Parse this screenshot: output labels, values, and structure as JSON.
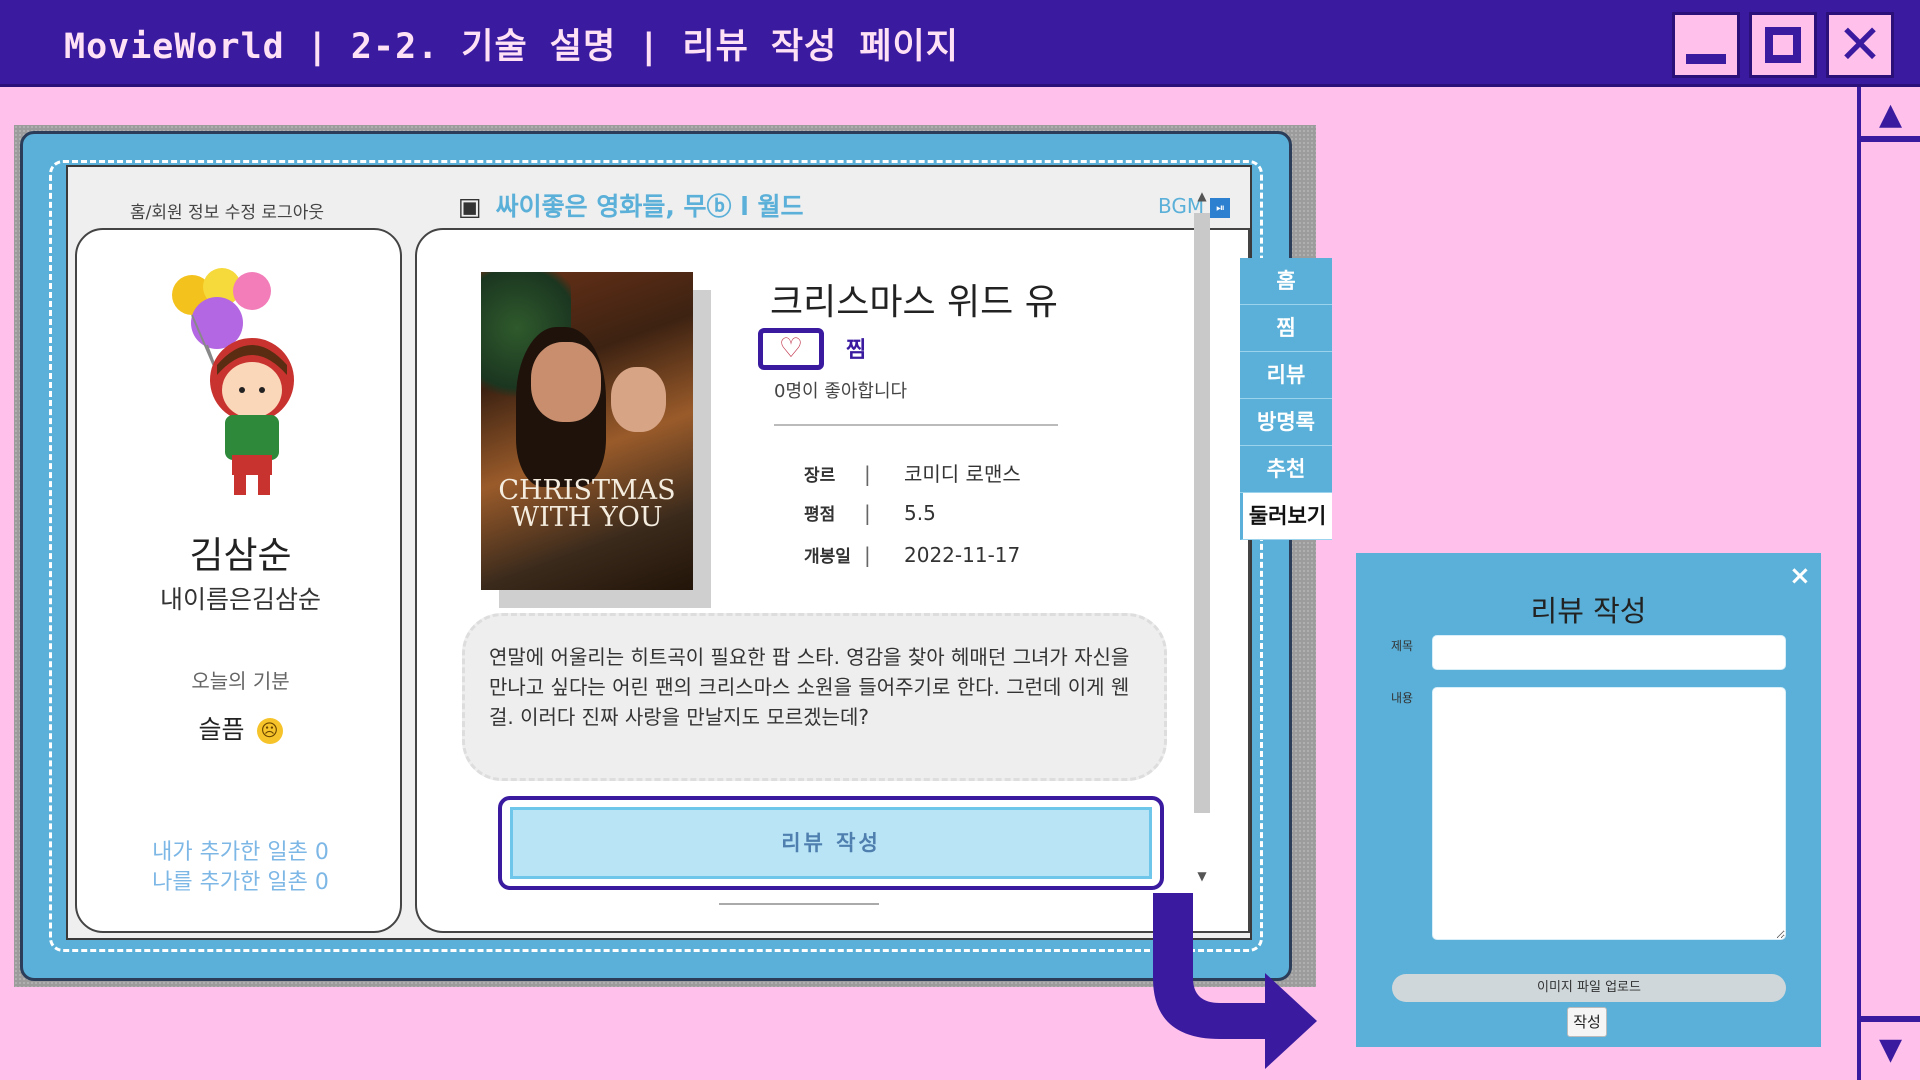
{
  "window": {
    "title": "MovieWorld | 2-2. 기술 설명 | 리뷰 작성 페이지",
    "minimize_icon": "minimize-icon",
    "maximize_icon": "maximize-icon",
    "close_glyph": "✕"
  },
  "scroll": {
    "up": "▲",
    "down": "▼"
  },
  "site": {
    "top_menu": "홈/회원 정보 수정   로그아웃",
    "logo_text": "싸이좋은 영화들, 무ⓑ l 월드",
    "logo_icon": "camera-icon",
    "bgm_label": "BGM",
    "bgm_icon": "⏯"
  },
  "profile": {
    "name": "김삼순",
    "message": "내이름은김삼순",
    "mood_label": "오늘의 기분",
    "mood": "슬픔",
    "mood_icon": "sad-face-icon",
    "friends_added": "내가 추가한 일촌 0",
    "friends_added_me": "나를 추가한 일촌 0"
  },
  "movie": {
    "title": "크리스마스 위드 유",
    "poster_title": "CHRISTMAS WITH YOU",
    "like_icon": "♡",
    "like_label": "찜",
    "like_count_text": "0명이 좋아합니다",
    "info": [
      {
        "key": "장르",
        "sep": "|",
        "value": "코미디 로맨스"
      },
      {
        "key": "평점",
        "sep": "|",
        "value": "5.5"
      },
      {
        "key": "개봉일",
        "sep": "|",
        "value": "2022-11-17"
      }
    ],
    "description": "연말에 어울리는 히트곡이 필요한 팝 스타. 영감을 찾아 헤매던 그녀가 자신을 만나고 싶다는 어린 팬의 크리스마스 소원을 들어주기로 한다. 그런데 이게 웬걸. 이러다 진짜 사랑을 만날지도 모르겠는데?",
    "review_button": "리뷰 작성"
  },
  "tabs": [
    {
      "label": "홈"
    },
    {
      "label": "찜"
    },
    {
      "label": "리뷰"
    },
    {
      "label": "방명록"
    },
    {
      "label": "추천"
    },
    {
      "label": "둘러보기",
      "active": true
    }
  ],
  "modal": {
    "title": "리뷰 작성",
    "close": "×",
    "title_label": "제목",
    "content_label": "내용",
    "title_value": "",
    "content_value": "",
    "upload_label": "이미지 파일 업로드",
    "submit_label": "작성"
  },
  "colors": {
    "accent_purple": "#3a1ba0",
    "background_pink": "#ffc1ec",
    "sky_blue": "#5ab0d8"
  }
}
